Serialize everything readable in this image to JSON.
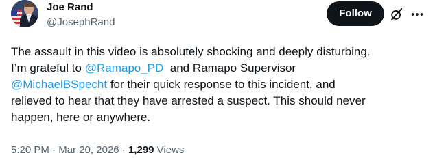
{
  "author": {
    "name": "Joe Rand",
    "handle": "@JosephRand"
  },
  "actions": {
    "follow_label": "Follow",
    "grok_icon": "grok-slash-circle-icon",
    "more_icon": "more-horizontal-icon"
  },
  "tweet": {
    "line1": "The assault in this video is absolutely shocking and deeply disturbing.",
    "line2_a": "I’m grateful to ",
    "mention1": "@Ramapo_PD",
    "line2_b": "  and Ramapo Supervisor",
    "mention2": "@MichaelBSpecht",
    "line3_b": " for their quick response to this incident, and",
    "line4": "relieved to hear that they have arrested a suspect. This should never",
    "line5": "happen, here or anywhere."
  },
  "meta": {
    "time": "5:20 PM",
    "sep1": " · ",
    "date": "Mar 20, 2026",
    "sep2": " · ",
    "views_count": "1,299",
    "views_label": " Views"
  },
  "colors": {
    "text": "#0f1419",
    "secondary": "#536471",
    "link": "#1d9bf0",
    "button_bg": "#0f1419",
    "button_text": "#ffffff"
  }
}
